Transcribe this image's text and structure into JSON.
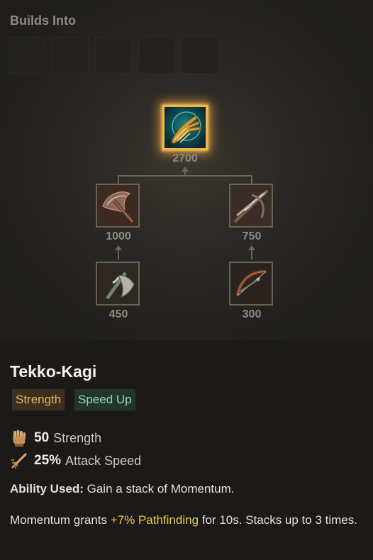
{
  "builds_into": {
    "title": "Builds Into",
    "slot_count": 5
  },
  "tree": {
    "main": {
      "cost": "2700",
      "icon": "tekko-kagi-claw-icon"
    },
    "left_mid": {
      "cost": "1000",
      "icon": "battle-axe-icon"
    },
    "right_mid": {
      "cost": "750",
      "icon": "crossed-blade-icon"
    },
    "left_low": {
      "cost": "450",
      "icon": "hand-axe-icon"
    },
    "right_low": {
      "cost": "300",
      "icon": "bow-icon"
    }
  },
  "item": {
    "name": "Tekko-Kagi",
    "tags": [
      "Strength",
      "Speed Up"
    ],
    "stats": [
      {
        "icon": "fist-icon",
        "value": "50",
        "name": "Strength"
      },
      {
        "icon": "sword-icon",
        "value": "25%",
        "name": "Attack Speed"
      }
    ],
    "ability_label": "Ability Used:",
    "ability_text": " Gain a stack of Momentum.",
    "passive_pre": "Momentum grants ",
    "passive_highlight": "+7% Pathfinding",
    "passive_post": " for 10s. Stacks up to 3 times."
  },
  "colors": {
    "main_glow": "#f0b64a",
    "strength_tag": "#e8b45a",
    "speed_tag": "#8fd9b2",
    "highlight": "#e8c84a"
  }
}
